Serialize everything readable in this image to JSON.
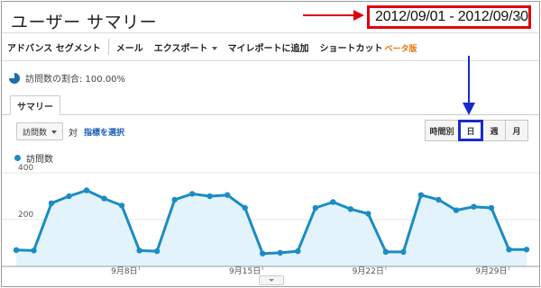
{
  "header": {
    "title": "ユーザー サマリー",
    "date_range": "2012/09/01 - 2012/09/30"
  },
  "toolbar": {
    "advanced_segments": "アドバンス セグメント",
    "email": "メール",
    "export": "エクスポート",
    "add_to_dashboard": "マイレポートに追加",
    "shortcut": "ショートカット",
    "beta": "ベータ版"
  },
  "segment": {
    "label": "訪問数の割合: 100.00%"
  },
  "tabs": {
    "summary": "サマリー"
  },
  "controls": {
    "metric": "訪問数",
    "vs": "対",
    "choose_metric": "指標を選択",
    "granularity": [
      "時間別",
      "日",
      "週",
      "月"
    ],
    "selected_granularity": "日"
  },
  "colors": {
    "series": "#1b8cc4",
    "fill": "#e3f3fb",
    "highlight_red": "#e0000a",
    "highlight_blue": "#1a2acd"
  },
  "chart_data": {
    "type": "area",
    "legend": "訪問数",
    "x": [
      "2012-09-01",
      "2012-09-02",
      "2012-09-03",
      "2012-09-04",
      "2012-09-05",
      "2012-09-06",
      "2012-09-07",
      "2012-09-08",
      "2012-09-09",
      "2012-09-10",
      "2012-09-11",
      "2012-09-12",
      "2012-09-13",
      "2012-09-14",
      "2012-09-15",
      "2012-09-16",
      "2012-09-17",
      "2012-09-18",
      "2012-09-19",
      "2012-09-20",
      "2012-09-21",
      "2012-09-22",
      "2012-09-23",
      "2012-09-24",
      "2012-09-25",
      "2012-09-26",
      "2012-09-27",
      "2012-09-28",
      "2012-09-29",
      "2012-09-30"
    ],
    "values": [
      70,
      68,
      270,
      300,
      325,
      290,
      260,
      68,
      65,
      285,
      310,
      300,
      305,
      250,
      55,
      58,
      65,
      250,
      275,
      245,
      225,
      62,
      62,
      305,
      285,
      240,
      255,
      250,
      72,
      72
    ],
    "ylim": [
      0,
      400
    ],
    "yticks": [
      "400",
      "200"
    ],
    "xtick_labels": [
      "9月8日",
      "9月15日",
      "9月22日",
      "9月29日"
    ],
    "xtick_indices": [
      7,
      14,
      21,
      28
    ],
    "grid": true
  }
}
